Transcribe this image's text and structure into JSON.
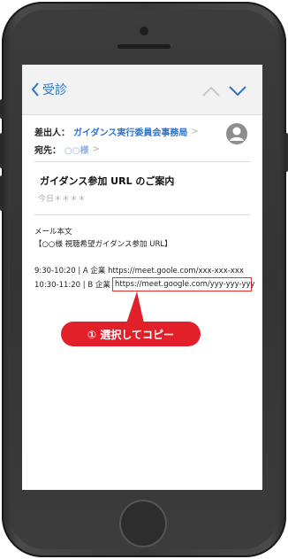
{
  "navbar": {
    "back_label": "受診",
    "up_icon": "chevron-up-icon",
    "down_icon": "chevron-down-icon"
  },
  "header": {
    "from_label": "差出人：",
    "from_value": "ガイダンス実行委員会事務局",
    "to_label": "宛先：",
    "to_value": "○○様",
    "chevron": ">"
  },
  "mail": {
    "subject": "ガイダンス参加 URL のご案内",
    "date": "今日＊＊＊＊",
    "body_title": "メール本文",
    "body_greeting": "【○○様 視聴希望ガイダンス参加 URL】",
    "line1": "9:30-10:20 | A 企業 https://meet.goole.com/xxx-xxx-xxx",
    "line2_prefix": "10:30-11:20 | B 企業",
    "line2_url": "https://meet.google.com/yyy-yyy-yyy"
  },
  "callout": {
    "label": "① 選択してコピー",
    "color": "#e1202a"
  },
  "colors": {
    "accent": "#2e74c9",
    "highlight": "#e03030"
  }
}
